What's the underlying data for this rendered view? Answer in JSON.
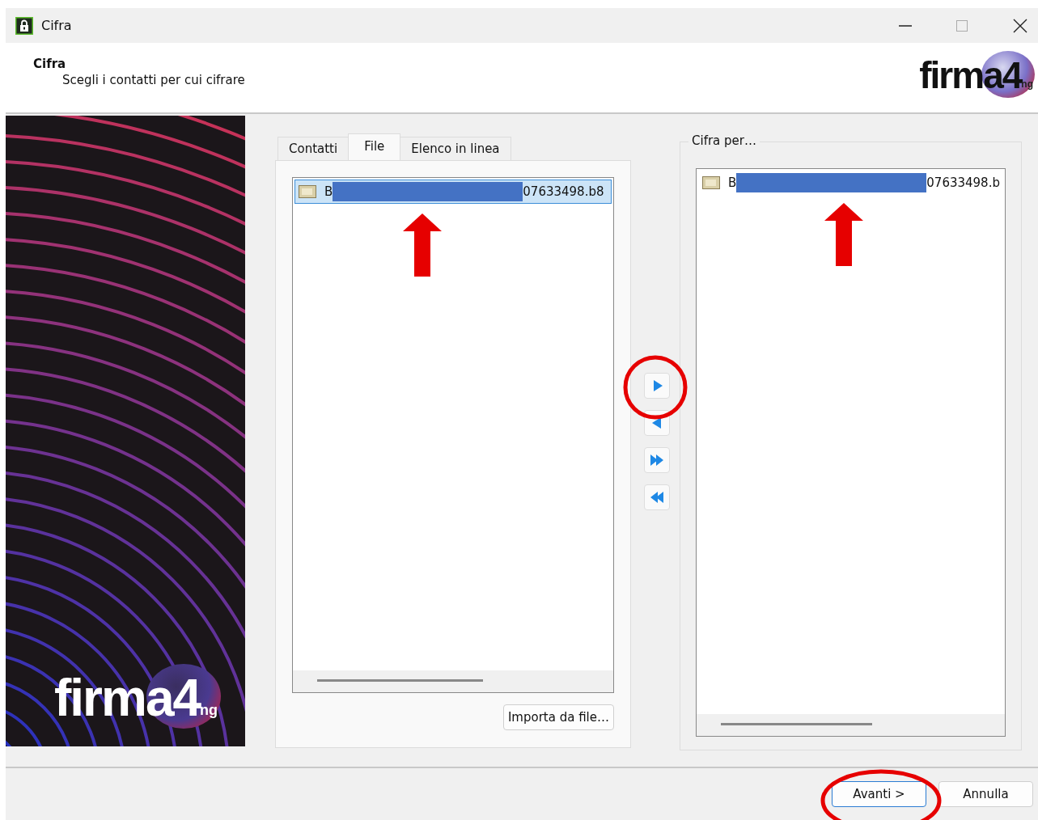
{
  "window": {
    "title": "Cifra"
  },
  "header": {
    "title": "Cifra",
    "subtitle": "Scegli i contatti per cui cifrare",
    "logo": {
      "name": "firma4",
      "suffix": "ng"
    }
  },
  "sidebar": {
    "logo": {
      "name": "firma4",
      "suffix": "ng"
    }
  },
  "tabs": [
    {
      "label": "Contatti",
      "selected": false
    },
    {
      "label": "File",
      "selected": true
    },
    {
      "label": "Elenco in linea",
      "selected": false
    }
  ],
  "file_list": {
    "items": [
      {
        "prefix": "B",
        "suffix": "07633498.b8",
        "selected": true,
        "redacted": true
      }
    ]
  },
  "import_button": "Importa da file…",
  "move_buttons": [
    {
      "kind": "add"
    },
    {
      "kind": "remove"
    },
    {
      "kind": "add-all"
    },
    {
      "kind": "remove-all"
    }
  ],
  "recipients": {
    "title": "Cifra per…",
    "items": [
      {
        "prefix": "B",
        "suffix": "07633498.b",
        "selected": false,
        "redacted": true
      }
    ]
  },
  "buttons": [
    {
      "label": "Avanti >",
      "default": true
    },
    {
      "label": "Annulla",
      "default": false
    }
  ]
}
